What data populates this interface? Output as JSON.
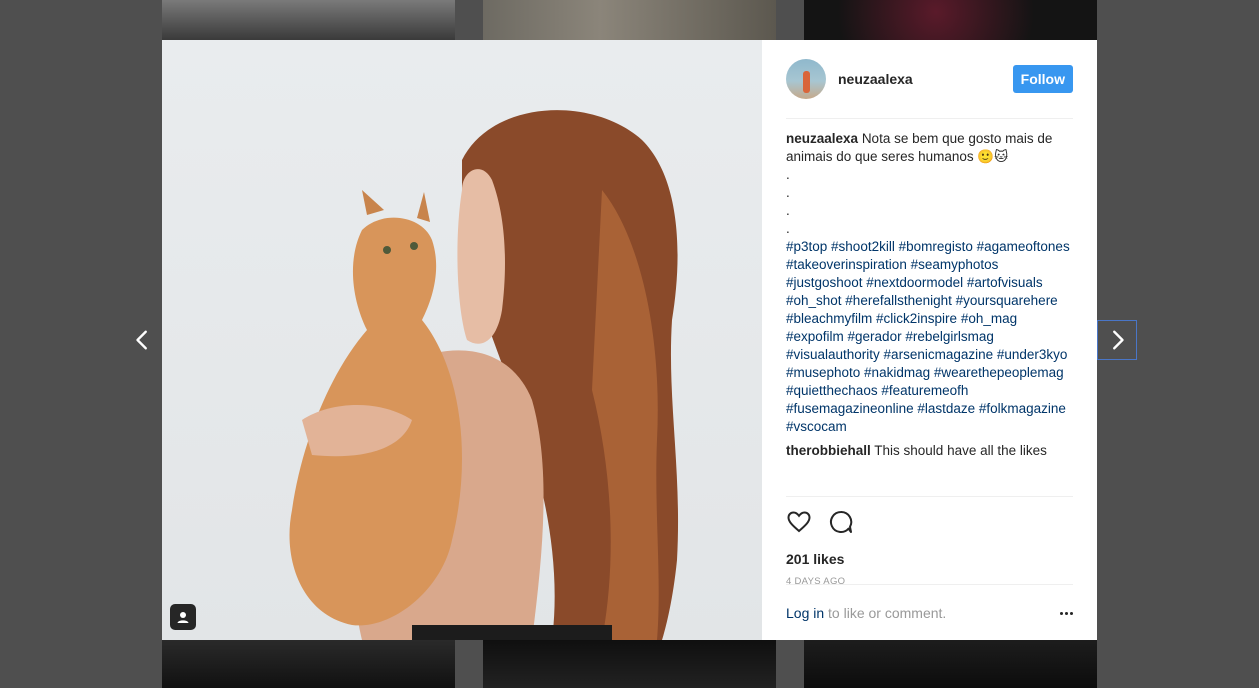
{
  "post": {
    "username": "neuzaalexa",
    "follow_label": "Follow",
    "caption_text": "Nota se bem que gosto mais de animais do que seres humanos 🙂🐱",
    "caption_dots": [
      ".",
      ".",
      ".",
      "."
    ],
    "hashtags": "#p3top #shoot2kill #bomregisto #agameoftones #takeoverinspiration #seamyphotos #justgoshoot #nextdoormodel #artofvisuals #oh_shot #herefallsthenight #yoursquarehere #bleachmyfilm #click2inspire #oh_mag #expofilm #gerador #rebelgirlsmag #visualauthority #arsenicmagazine #under3kyo #musephoto #nakidmag #wearethepeoplemag #quietthechaos #featuremeofh #fusemagazineonline #lastdaze #folkmagazine #vscocam",
    "comment": {
      "username": "therobbiehall",
      "text": "This should have all the likes"
    },
    "likes": "201 likes",
    "time_ago": "4 DAYS AGO",
    "login_link": "Log in",
    "login_suffix": " to like or comment."
  },
  "icons": {
    "prev": "chevron-left-icon",
    "next": "chevron-right-icon",
    "like": "heart-icon",
    "comment": "comment-icon",
    "tagged": "user-tag-icon",
    "more": "more-options-icon"
  },
  "colors": {
    "accent": "#3897f0",
    "hashtag": "#003569",
    "overlay": "#4f4f4f"
  }
}
